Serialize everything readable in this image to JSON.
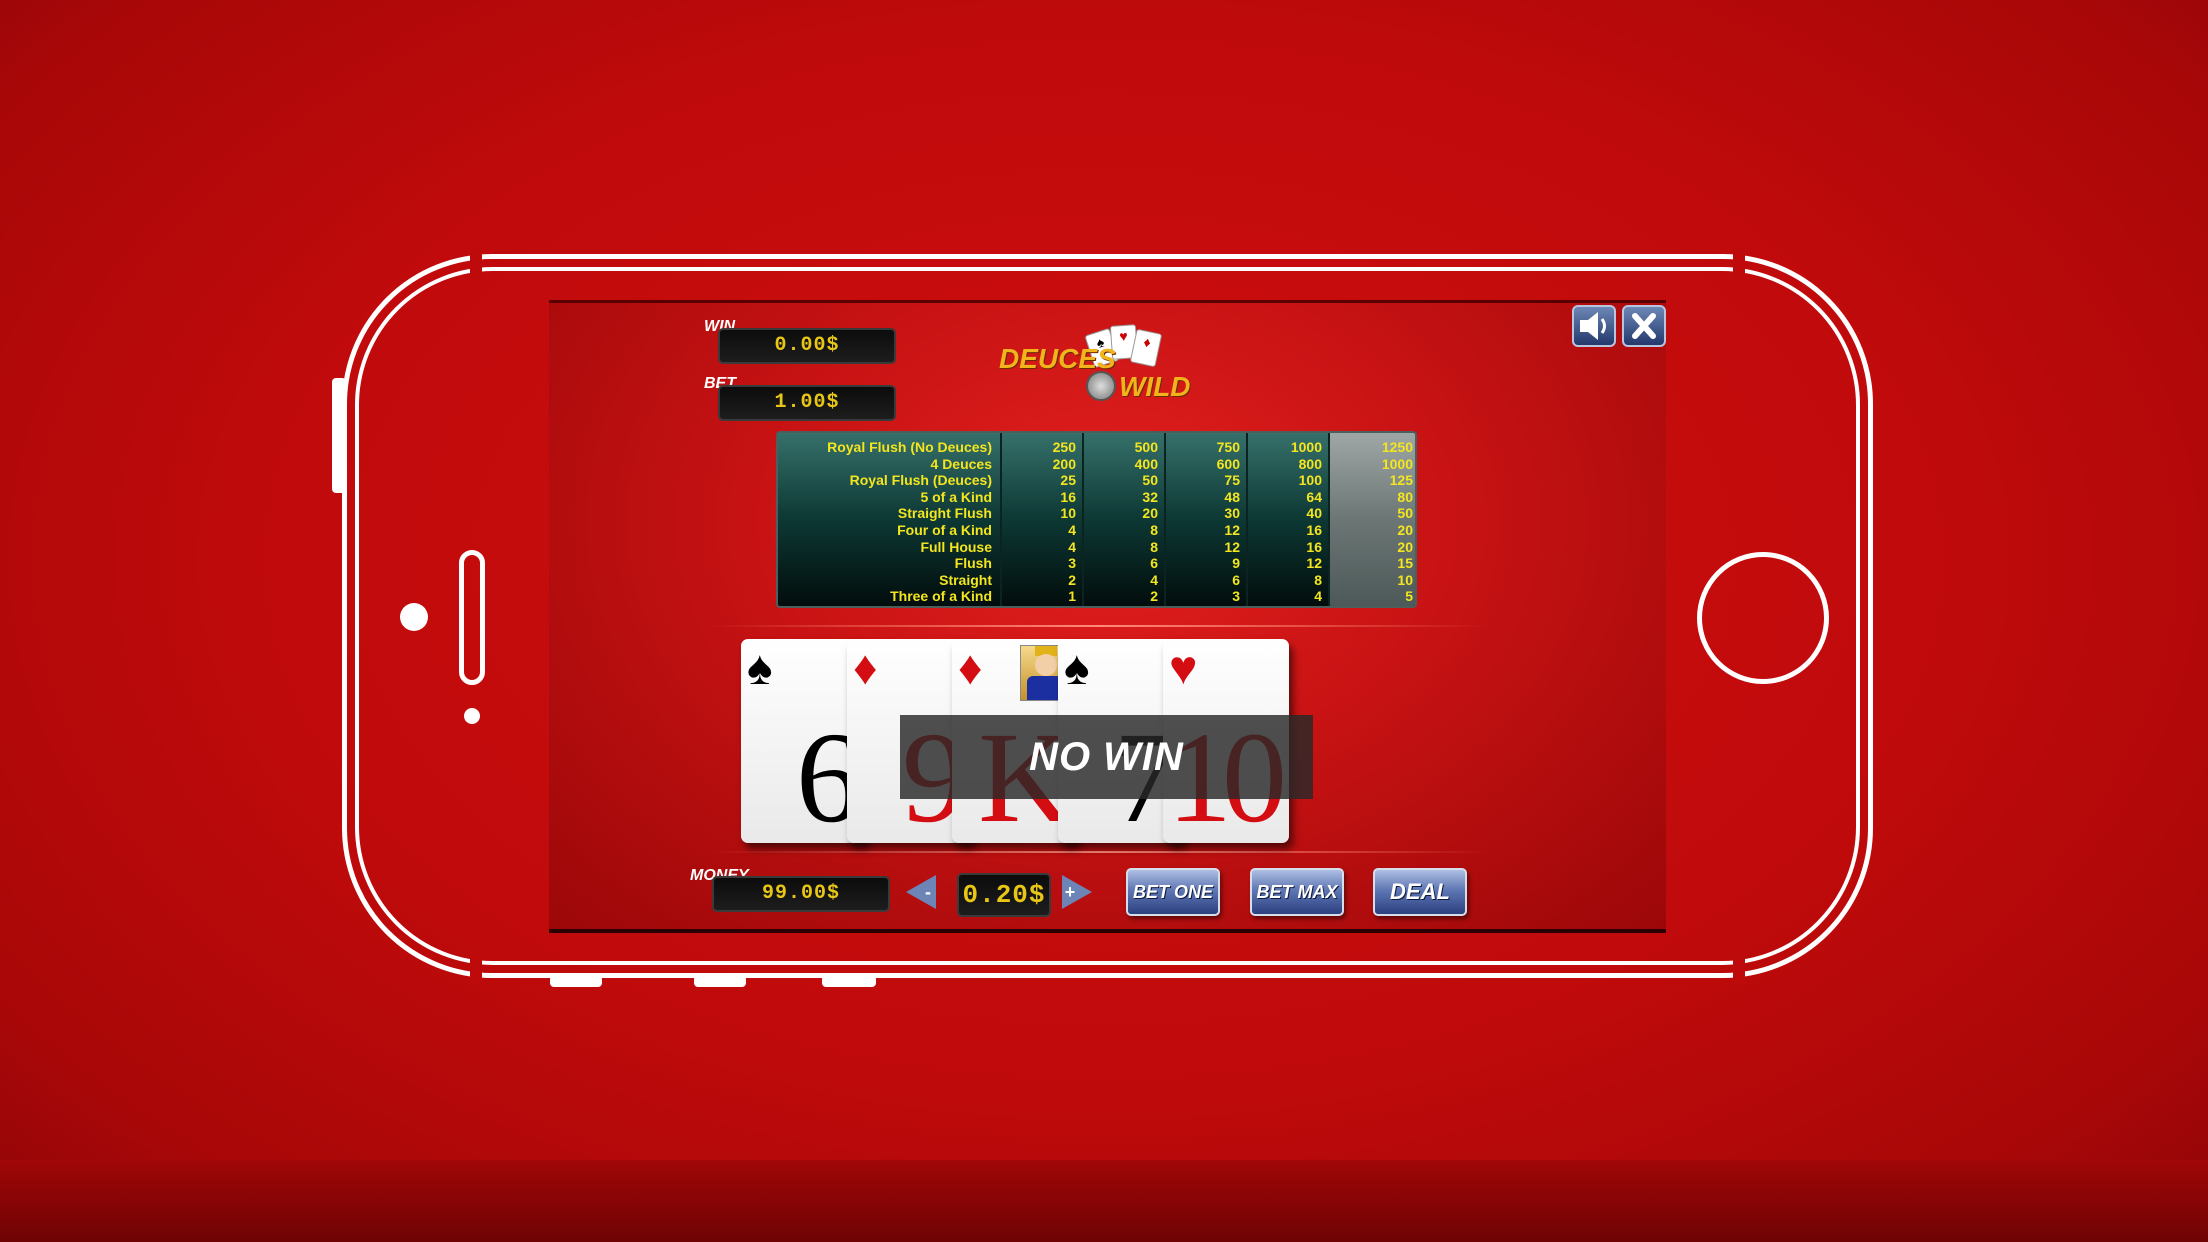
{
  "game": {
    "logo_word1": "DEUCES",
    "logo_word2": "WILD",
    "sound_icon": "speaker-icon",
    "close_icon": "close-icon"
  },
  "meters": {
    "win_label": "WIN",
    "win_value": "0.00$",
    "bet_label": "BET",
    "bet_value": "1.00$",
    "money_label": "MONEY",
    "money_value": "99.00$",
    "coin_value": "0.20$"
  },
  "paytable": {
    "hands": [
      "Royal Flush (No Deuces)",
      "4 Deuces",
      "Royal Flush (Deuces)",
      "5 of a Kind",
      "Straight Flush",
      "Four of a Kind",
      "Full House",
      "Flush",
      "Straight",
      "Three of a Kind"
    ],
    "columns": [
      [
        "250",
        "200",
        "25",
        "16",
        "10",
        "4",
        "4",
        "3",
        "2",
        "1"
      ],
      [
        "500",
        "400",
        "50",
        "32",
        "20",
        "8",
        "8",
        "6",
        "4",
        "2"
      ],
      [
        "750",
        "600",
        "75",
        "48",
        "30",
        "12",
        "12",
        "9",
        "6",
        "3"
      ],
      [
        "1000",
        "800",
        "100",
        "64",
        "40",
        "16",
        "16",
        "12",
        "8",
        "4"
      ],
      [
        "1250",
        "1000",
        "125",
        "80",
        "50",
        "20",
        "20",
        "15",
        "10",
        "5"
      ]
    ],
    "highlighted_column": 5
  },
  "hand": [
    {
      "rank": "6",
      "suit": "♠",
      "color": "black"
    },
    {
      "rank": "9",
      "suit": "♦",
      "color": "red"
    },
    {
      "rank": "K",
      "suit": "♦",
      "color": "red"
    },
    {
      "rank": "7",
      "suit": "♠",
      "color": "black"
    },
    {
      "rank": "10",
      "suit": "♥",
      "color": "red"
    }
  ],
  "result_text": "NO WIN",
  "controls": {
    "minus_label": "-",
    "plus_label": "+",
    "bet_one_label": "BET ONE",
    "bet_max_label": "BET MAX",
    "deal_label": "DEAL"
  },
  "colors": {
    "background": "#bf0a0b",
    "accent_yellow": "#f3e51e",
    "button_blue": "#3d5597"
  }
}
